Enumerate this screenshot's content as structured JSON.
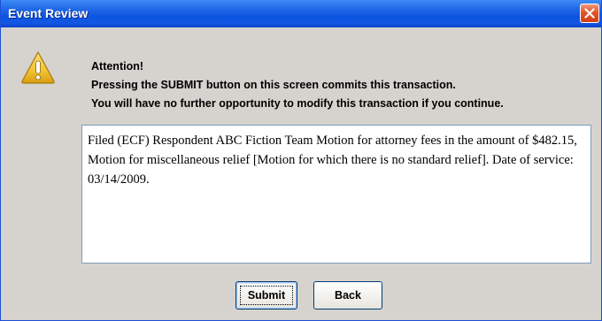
{
  "window": {
    "title": "Event Review",
    "close_icon": "close-icon"
  },
  "dialog": {
    "icon": "warning-icon",
    "message_lines": [
      "Attention!",
      "Pressing the SUBMIT button on this screen commits this transaction.",
      "You will have no further opportunity to modify this transaction if you continue."
    ],
    "detail_text": "Filed (ECF) Respondent ABC Fiction Team Motion for attorney fees in the amount of $482.15, Motion for miscellaneous relief [Motion for which there is no standard relief]. Date of service: 03/14/2009."
  },
  "buttons": {
    "submit_label": "Submit",
    "back_label": "Back"
  },
  "colors": {
    "titlebar": "#0c55e0",
    "window_bg": "#d6d3ce",
    "close_button": "#e5532b",
    "warning_fill": "#f2c233"
  }
}
